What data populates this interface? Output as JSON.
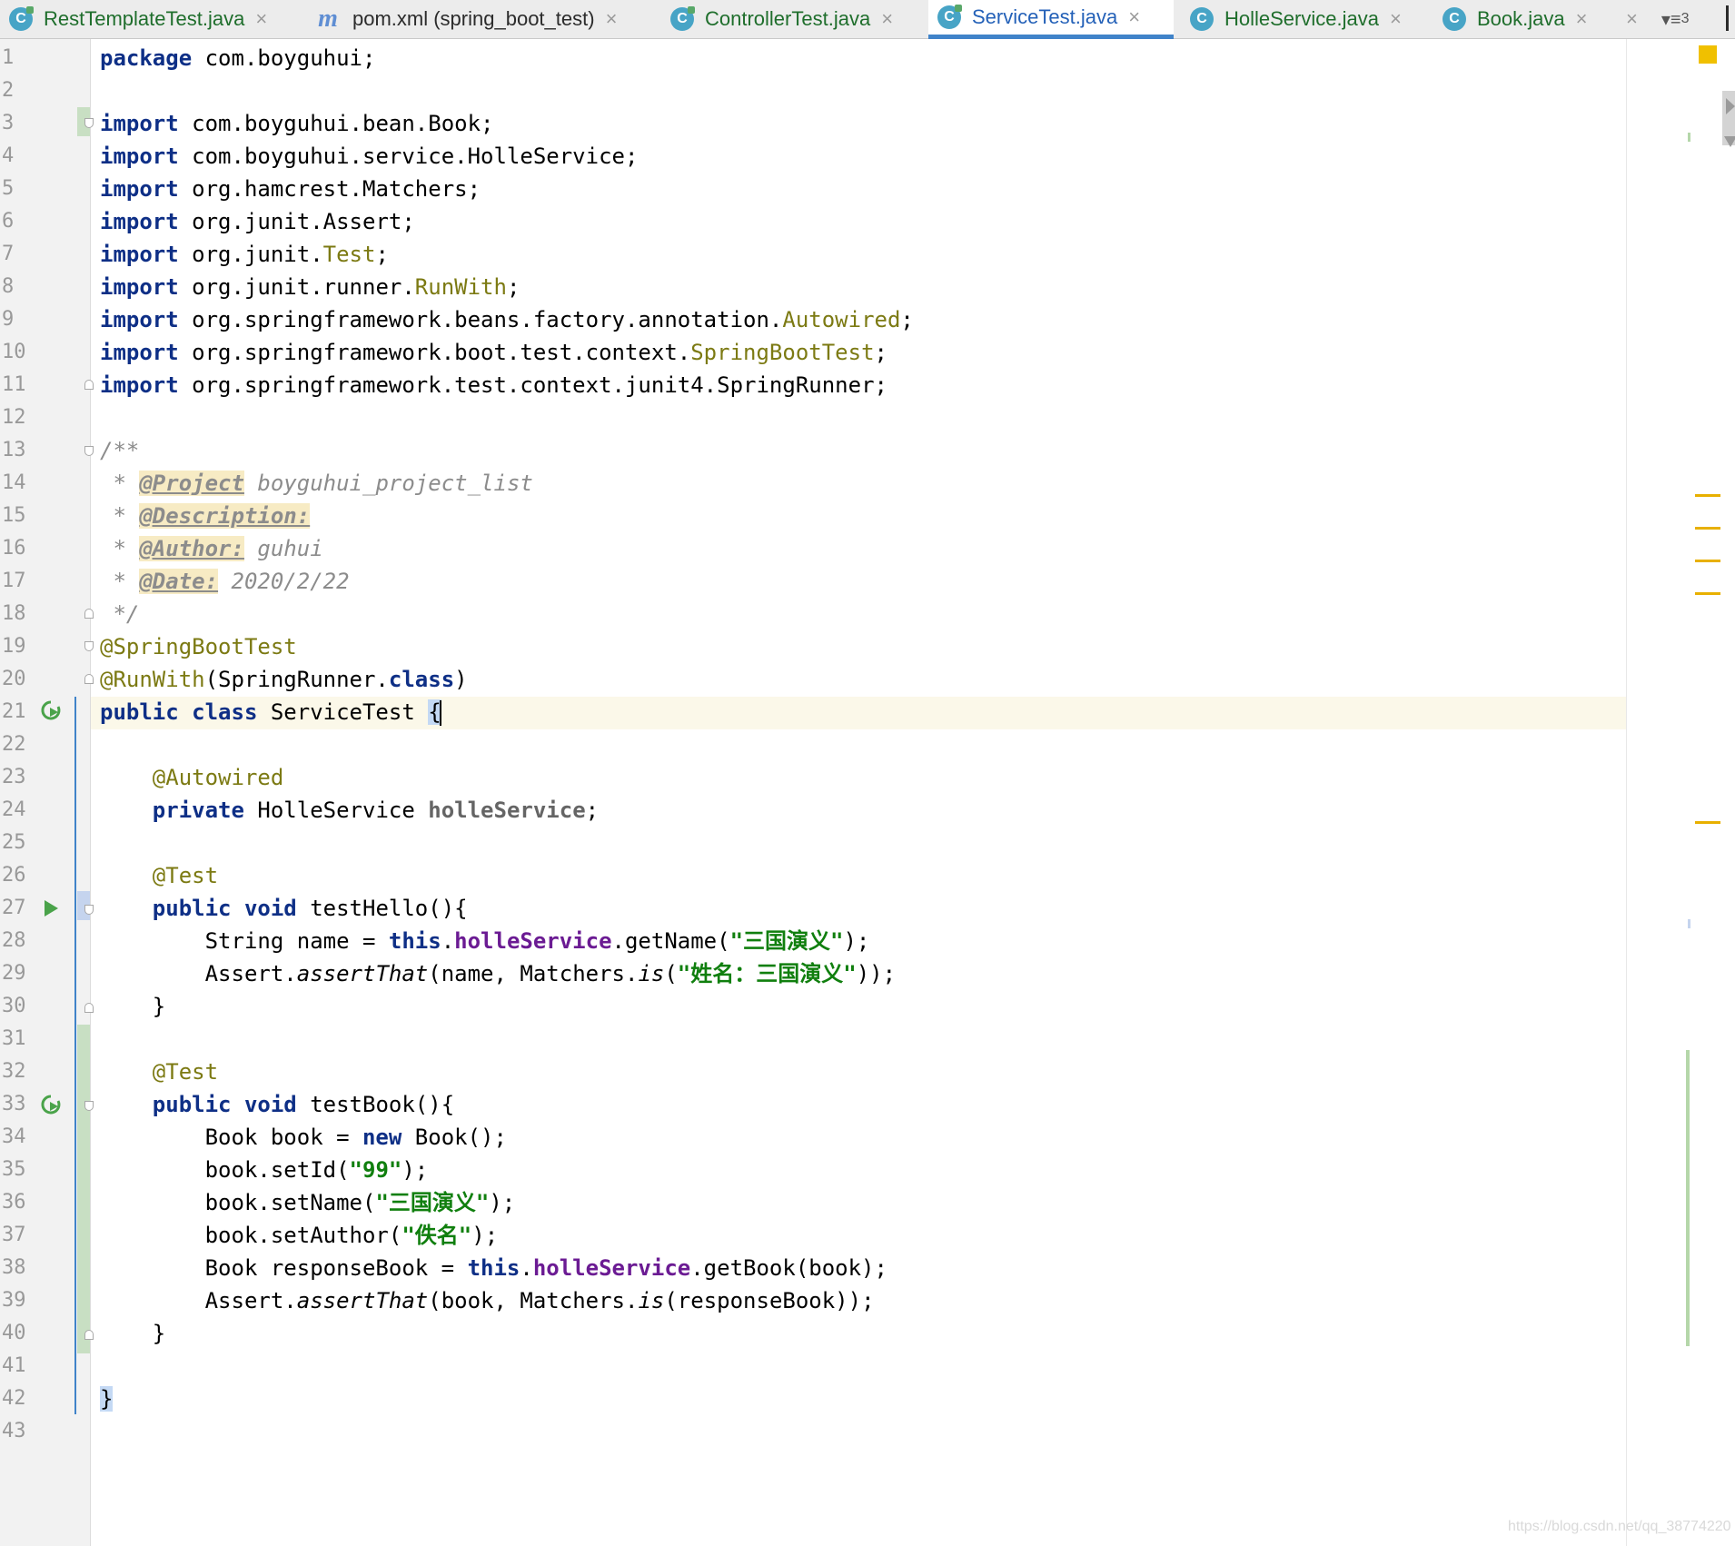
{
  "tabs": [
    {
      "label": "RestTemplateTest.java",
      "icon": "java-class-test-icon",
      "active": false
    },
    {
      "label": "pom.xml (spring_boot_test)",
      "icon": "maven-icon",
      "active": false
    },
    {
      "label": "ControllerTest.java",
      "icon": "java-class-test-icon",
      "active": false
    },
    {
      "label": "ServiceTest.java",
      "icon": "java-class-test-icon",
      "active": true
    },
    {
      "label": "HolleService.java",
      "icon": "java-class-icon",
      "active": false
    },
    {
      "label": "Book.java",
      "icon": "java-class-icon",
      "active": false
    }
  ],
  "tab_overflow": {
    "count": "3"
  },
  "editor": {
    "file": "ServiceTest.java",
    "caret_line": 21,
    "line_numbers": [
      "1",
      "2",
      "3",
      "4",
      "5",
      "6",
      "7",
      "8",
      "9",
      "10",
      "11",
      "12",
      "13",
      "14",
      "15",
      "16",
      "17",
      "18",
      "19",
      "20",
      "21",
      "22",
      "23",
      "24",
      "25",
      "26",
      "27",
      "28",
      "29",
      "30",
      "31",
      "32",
      "33",
      "34",
      "35",
      "36",
      "37",
      "38",
      "39",
      "40",
      "41",
      "42",
      "43"
    ],
    "lines": [
      [
        {
          "t": "package",
          "c": "kw"
        },
        {
          "t": " com.boyguhui;",
          "c": ""
        }
      ],
      [],
      [
        {
          "t": "import",
          "c": "kw"
        },
        {
          "t": " com.boyguhui.bean.Book;",
          "c": ""
        }
      ],
      [
        {
          "t": "import",
          "c": "kw"
        },
        {
          "t": " com.boyguhui.service.HolleService;",
          "c": ""
        }
      ],
      [
        {
          "t": "import",
          "c": "kw"
        },
        {
          "t": " org.hamcrest.Matchers;",
          "c": ""
        }
      ],
      [
        {
          "t": "import",
          "c": "kw"
        },
        {
          "t": " org.junit.Assert;",
          "c": ""
        }
      ],
      [
        {
          "t": "import",
          "c": "kw"
        },
        {
          "t": " org.junit.",
          "c": ""
        },
        {
          "t": "Test",
          "c": "ann"
        },
        {
          "t": ";",
          "c": ""
        }
      ],
      [
        {
          "t": "import",
          "c": "kw"
        },
        {
          "t": " org.junit.runner.",
          "c": ""
        },
        {
          "t": "RunWith",
          "c": "ann"
        },
        {
          "t": ";",
          "c": ""
        }
      ],
      [
        {
          "t": "import",
          "c": "kw"
        },
        {
          "t": " org.springframework.beans.factory.annotation.",
          "c": ""
        },
        {
          "t": "Autowired",
          "c": "ann"
        },
        {
          "t": ";",
          "c": ""
        }
      ],
      [
        {
          "t": "import",
          "c": "kw"
        },
        {
          "t": " org.springframework.boot.test.context.",
          "c": ""
        },
        {
          "t": "SpringBootTest",
          "c": "ann"
        },
        {
          "t": ";",
          "c": ""
        }
      ],
      [
        {
          "t": "import",
          "c": "kw"
        },
        {
          "t": " org.springframework.test.context.junit4.SpringRunner;",
          "c": ""
        }
      ],
      [],
      [
        {
          "t": "/**",
          "c": "cm"
        }
      ],
      [
        {
          "t": " * ",
          "c": "cm"
        },
        {
          "t": "@Project",
          "c": "tag"
        },
        {
          "t": " boyguhui_project_list",
          "c": "cm"
        }
      ],
      [
        {
          "t": " * ",
          "c": "cm"
        },
        {
          "t": "@Description:",
          "c": "tag"
        }
      ],
      [
        {
          "t": " * ",
          "c": "cm"
        },
        {
          "t": "@Author:",
          "c": "tag"
        },
        {
          "t": " guhui",
          "c": "cm"
        }
      ],
      [
        {
          "t": " * ",
          "c": "cm"
        },
        {
          "t": "@Date:",
          "c": "tag"
        },
        {
          "t": " 2020/2/22",
          "c": "cm"
        }
      ],
      [
        {
          "t": " */",
          "c": "cm"
        }
      ],
      [
        {
          "t": "@SpringBootTest",
          "c": "ann"
        }
      ],
      [
        {
          "t": "@RunWith",
          "c": "ann"
        },
        {
          "t": "(SpringRunner.",
          "c": ""
        },
        {
          "t": "class",
          "c": "kw"
        },
        {
          "t": ")",
          "c": ""
        }
      ],
      [
        {
          "t": "public class",
          "c": "kw"
        },
        {
          "t": " ServiceTest ",
          "c": ""
        },
        {
          "t": "{",
          "c": "brace-hl"
        }
      ],
      [],
      [
        {
          "t": "    ",
          "c": ""
        },
        {
          "t": "@Autowired",
          "c": "ann"
        }
      ],
      [
        {
          "t": "    ",
          "c": ""
        },
        {
          "t": "private",
          "c": "kw"
        },
        {
          "t": " HolleService ",
          "c": ""
        },
        {
          "t": "holleService",
          "c": "fieldg"
        },
        {
          "t": ";",
          "c": ""
        }
      ],
      [],
      [
        {
          "t": "    ",
          "c": ""
        },
        {
          "t": "@Test",
          "c": "ann"
        }
      ],
      [
        {
          "t": "    ",
          "c": ""
        },
        {
          "t": "public void",
          "c": "kw"
        },
        {
          "t": " testHello(){",
          "c": ""
        }
      ],
      [
        {
          "t": "        String name = ",
          "c": ""
        },
        {
          "t": "this",
          "c": "kw"
        },
        {
          "t": ".",
          "c": ""
        },
        {
          "t": "holleService",
          "c": "field"
        },
        {
          "t": ".getName(",
          "c": ""
        },
        {
          "t": "\"三国演义\"",
          "c": "str"
        },
        {
          "t": ");",
          "c": ""
        }
      ],
      [
        {
          "t": "        Assert.",
          "c": ""
        },
        {
          "t": "assertThat",
          "c": "ital"
        },
        {
          "t": "(name, Matchers.",
          "c": ""
        },
        {
          "t": "is",
          "c": "ital"
        },
        {
          "t": "(",
          "c": ""
        },
        {
          "t": "\"姓名：三国演义\"",
          "c": "str"
        },
        {
          "t": "));",
          "c": ""
        }
      ],
      [
        {
          "t": "    }",
          "c": ""
        }
      ],
      [],
      [
        {
          "t": "    ",
          "c": ""
        },
        {
          "t": "@Test",
          "c": "ann"
        }
      ],
      [
        {
          "t": "    ",
          "c": ""
        },
        {
          "t": "public void",
          "c": "kw"
        },
        {
          "t": " testBook(){",
          "c": ""
        }
      ],
      [
        {
          "t": "        Book book = ",
          "c": ""
        },
        {
          "t": "new",
          "c": "kw"
        },
        {
          "t": " Book();",
          "c": ""
        }
      ],
      [
        {
          "t": "        book.setId(",
          "c": ""
        },
        {
          "t": "\"99\"",
          "c": "str"
        },
        {
          "t": ");",
          "c": ""
        }
      ],
      [
        {
          "t": "        book.setName(",
          "c": ""
        },
        {
          "t": "\"三国演义\"",
          "c": "str"
        },
        {
          "t": ");",
          "c": ""
        }
      ],
      [
        {
          "t": "        book.setAuthor(",
          "c": ""
        },
        {
          "t": "\"佚名\"",
          "c": "str"
        },
        {
          "t": ");",
          "c": ""
        }
      ],
      [
        {
          "t": "        Book responseBook = ",
          "c": ""
        },
        {
          "t": "this",
          "c": "kw"
        },
        {
          "t": ".",
          "c": ""
        },
        {
          "t": "holleService",
          "c": "field"
        },
        {
          "t": ".getBook(book);",
          "c": ""
        }
      ],
      [
        {
          "t": "        Assert.",
          "c": ""
        },
        {
          "t": "assertThat",
          "c": "ital"
        },
        {
          "t": "(book, Matchers.",
          "c": ""
        },
        {
          "t": "is",
          "c": "ital"
        },
        {
          "t": "(responseBook));",
          "c": ""
        }
      ],
      [
        {
          "t": "    }",
          "c": ""
        }
      ],
      [],
      [
        {
          "t": "}",
          "c": "brace-hl"
        }
      ],
      []
    ]
  },
  "watermark": "https://blog.csdn.net/qq_38774220",
  "colors": {
    "keyword": "#0e2f86",
    "annotation": "#7c7a13",
    "string": "#107f0e",
    "field": "#6b1b93",
    "comment": "#8c8c8c",
    "active_tab_accent": "#4083c9"
  }
}
